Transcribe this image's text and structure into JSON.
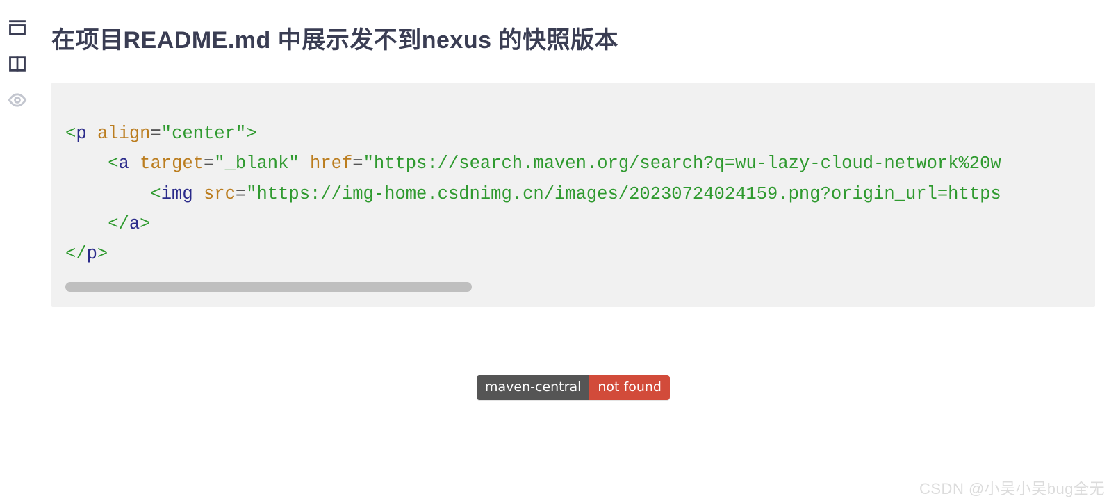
{
  "heading": "在项目README.md 中展示发不到nexus 的快照版本",
  "code": {
    "line1": {
      "open": "<",
      "tag": "p",
      "sp": " ",
      "attr": "align",
      "eq": "=",
      "val": "\"center\"",
      "close": ">"
    },
    "indent2": "    ",
    "line2": {
      "open": "<",
      "tag": "a",
      "sp": " ",
      "attr1": "target",
      "eq1": "=",
      "val1": "\"_blank\"",
      "sp2": " ",
      "attr2": "href",
      "eq2": "=",
      "val2": "\"https://search.maven.org/search?q=wu-lazy-cloud-network%20w"
    },
    "indent3": "        ",
    "line3": {
      "open": "<",
      "tag": "img",
      "sp": " ",
      "attr": "src",
      "eq": "=",
      "val": "\"https://img-home.csdnimg.cn/images/20230724024159.png?origin_url=https"
    },
    "line4": {
      "open": "</",
      "tag": "a",
      "close": ">"
    },
    "line5": {
      "open": "</",
      "tag": "p",
      "close": ">"
    }
  },
  "badge": {
    "left": "maven-central",
    "right": "not found"
  },
  "watermark": "CSDN @小吴小吴bug全无"
}
